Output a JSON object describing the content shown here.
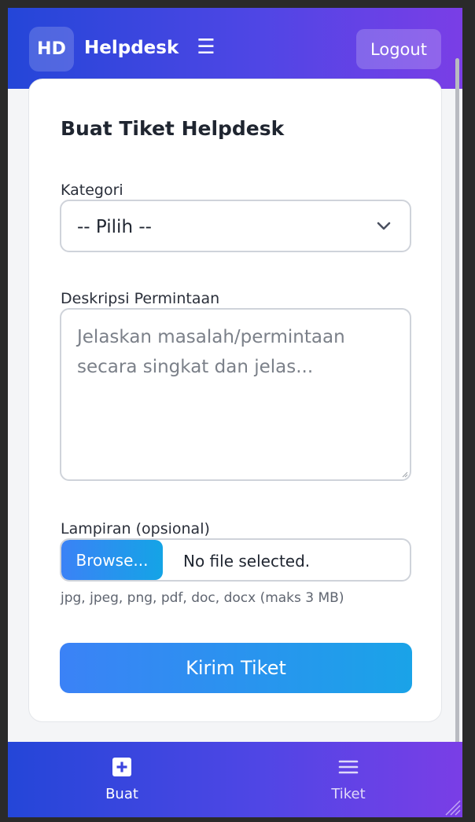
{
  "header": {
    "logo_text": "HD",
    "brand": "Helpdesk",
    "menu_icon": "hamburger-icon",
    "logout_label": "Logout"
  },
  "form": {
    "title": "Buat Tiket Helpdesk",
    "category": {
      "label": "Kategori",
      "selected": "-- Pilih --"
    },
    "description": {
      "label": "Deskripsi Permintaan",
      "placeholder": "Jelaskan masalah/permintaan secara singkat dan jelas..."
    },
    "attachment": {
      "label": "Lampiran (opsional)",
      "browse_label": "Browse...",
      "status": "No file selected.",
      "hint": "jpg, jpeg, png, pdf, doc, docx (maks 3 MB)"
    },
    "submit_label": "Kirim Tiket"
  },
  "bottom_nav": {
    "items": [
      {
        "label": "Buat",
        "icon": "plus-square-icon",
        "active": true
      },
      {
        "label": "Tiket",
        "icon": "list-icon",
        "active": false
      }
    ]
  },
  "colors": {
    "gradient_start": "#2446d8",
    "gradient_end": "#7a3ee6",
    "primary_button": "#3b82f6",
    "primary_button_end": "#14a4e6"
  }
}
